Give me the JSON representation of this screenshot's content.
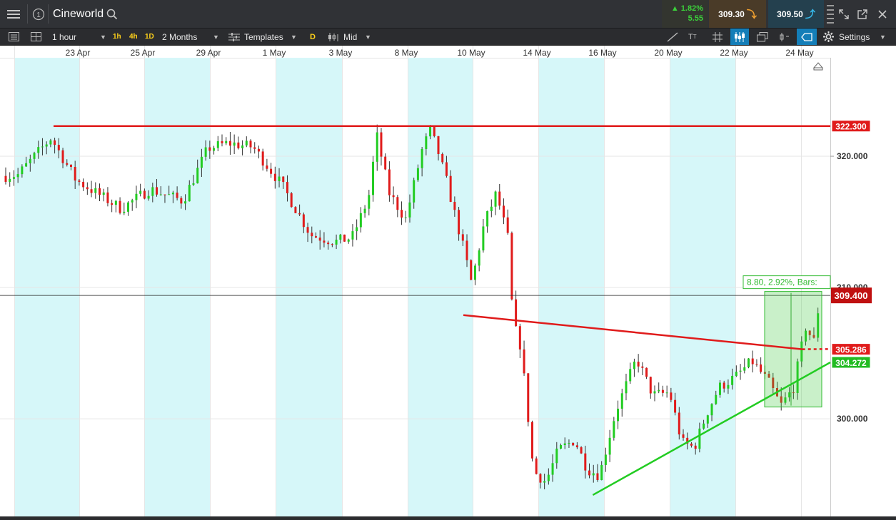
{
  "header": {
    "instrument": "Cineworld",
    "change_pct": "1.82%",
    "change_abs": "5.55",
    "sell_price": "309.30",
    "buy_price": "309.50"
  },
  "toolbar": {
    "interval": "1 hour",
    "quick_1h": "1h",
    "quick_4h": "4h",
    "quick_1d": "1D",
    "range": "2 Months",
    "templates": "Templates",
    "d_badge": "D",
    "price_type": "Mid",
    "settings": "Settings"
  },
  "chart_data": {
    "type": "candlestick",
    "instrument": "Cineworld",
    "x_labels": [
      "23 Apr",
      "25 Apr",
      "29 Apr",
      "1 May",
      "3 May",
      "8 May",
      "10 May",
      "14 May",
      "16 May",
      "20 May",
      "22 May",
      "24 May"
    ],
    "y_ticks": [
      "320.000",
      "310.000",
      "300.000"
    ],
    "ylim": [
      293.0,
      327.5
    ],
    "current_price": "309.400",
    "resistance": {
      "label": "322.300",
      "value": 322.3,
      "color": "#e01b1b"
    },
    "falling_trendline": {
      "label": "305.286",
      "from": [
        0.555,
        307.9
      ],
      "to": [
        0.966,
        305.3
      ],
      "color": "#e01b1b"
    },
    "rising_trendline": {
      "label": "304.272",
      "from": [
        0.712,
        294.2
      ],
      "to": [
        1.0,
        304.3
      ],
      "color": "#22cc22"
    },
    "measure_box": {
      "label": "8.80, 2.92%, Bars:",
      "from_value": 300.9,
      "to_value": 309.7
    },
    "colors": {
      "up": "#22cc22",
      "down": "#e01b1b",
      "weekend_band": "#d6f7f9"
    }
  }
}
